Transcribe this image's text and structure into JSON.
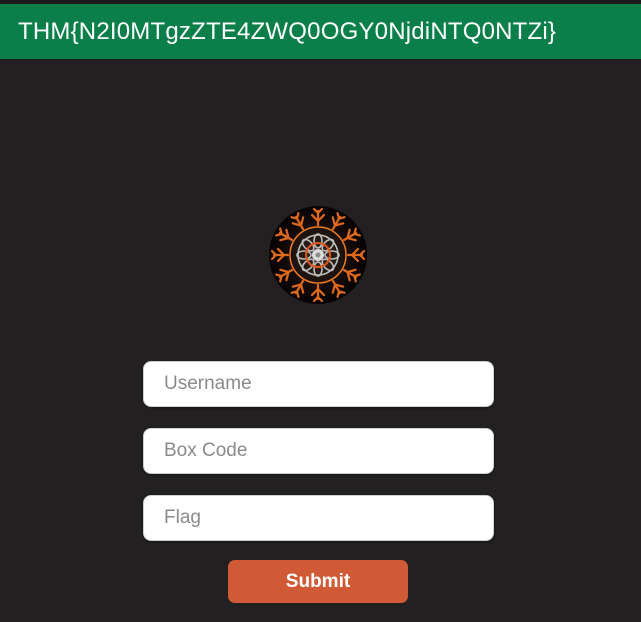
{
  "banner": {
    "flag_text": "THM{N2I0MTgzZTE4ZWQ0OGY0NjdiNTQ0NTZi}",
    "color": "#0b7f4a"
  },
  "logo": {
    "icon": "mandala-logo-icon"
  },
  "form": {
    "username_placeholder": "Username",
    "username_value": "",
    "boxcode_placeholder": "Box Code",
    "boxcode_value": "",
    "flag_placeholder": "Flag",
    "flag_value": "",
    "submit_label": "Submit",
    "submit_color": "#d15a36"
  },
  "theme": {
    "background": "#222021"
  }
}
